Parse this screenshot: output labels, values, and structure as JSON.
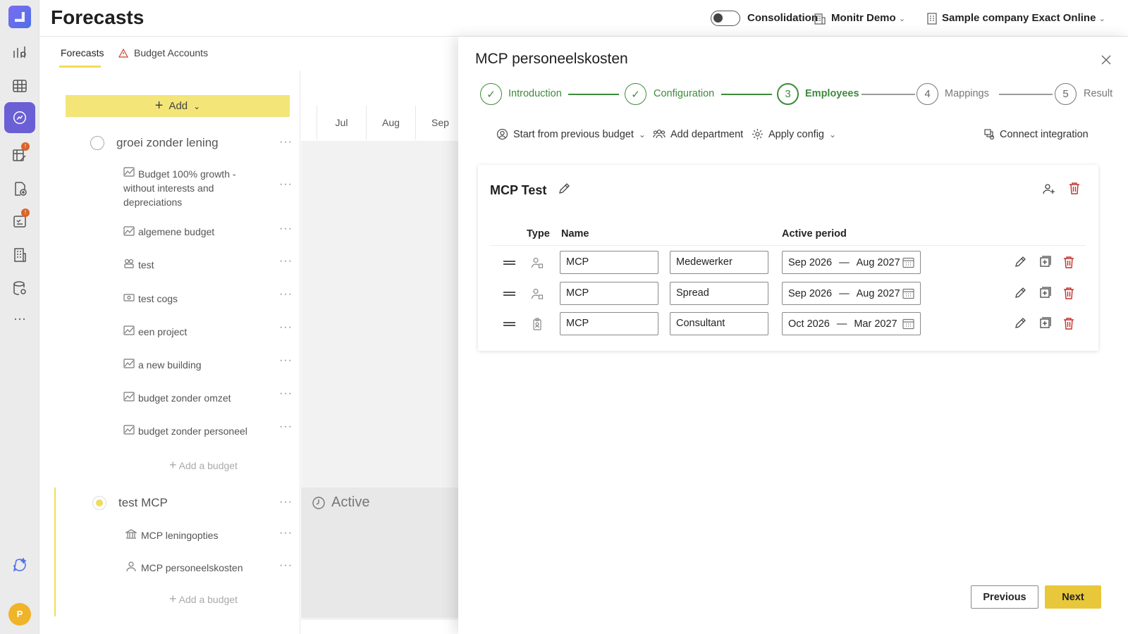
{
  "header": {
    "page_title": "Forecasts",
    "consolidation_label": "Consolidation",
    "org_label": "Monitr Demo",
    "company_label": "Sample company Exact Online"
  },
  "tabs": [
    {
      "label": "Forecasts",
      "active": true
    },
    {
      "label": "Budget Accounts",
      "active": false,
      "icon": "warning-icon"
    }
  ],
  "toolbar": {
    "add_label": "Add"
  },
  "grid_months": [
    "Jul",
    "Aug",
    "Sep"
  ],
  "tree": {
    "group1": {
      "label": "groei zonder lening",
      "items": [
        {
          "label": "Budget 100% growth -",
          "label2": "without interests and",
          "label3": "depreciations",
          "icon": "scenario-icon"
        },
        {
          "label": "algemene budget",
          "icon": "scenario-icon"
        },
        {
          "label": "test",
          "icon": "group-icon"
        },
        {
          "label": "test cogs",
          "icon": "money-icon"
        },
        {
          "label": "een project",
          "icon": "scenario-icon"
        },
        {
          "label": "a new building",
          "icon": "scenario-icon"
        },
        {
          "label": "budget zonder omzet",
          "icon": "scenario-icon"
        },
        {
          "label": "budget zonder personeel",
          "icon": "scenario-icon"
        }
      ],
      "add_label": "Add a budget"
    },
    "group2": {
      "label": "test MCP",
      "status_label": "Active",
      "items": [
        {
          "label": "MCP leningopties",
          "icon": "bank-icon"
        },
        {
          "label": "MCP personeelskosten",
          "icon": "person-icon"
        }
      ],
      "add_label": "Add a budget"
    }
  },
  "modal": {
    "title": "MCP personeelskosten",
    "steps": [
      {
        "number": "1",
        "label": "Introduction",
        "state": "done"
      },
      {
        "number": "2",
        "label": "Configuration",
        "state": "done"
      },
      {
        "number": "3",
        "label": "Employees",
        "state": "current"
      },
      {
        "number": "4",
        "label": "Mappings",
        "state": "todo"
      },
      {
        "number": "5",
        "label": "Result",
        "state": "todo"
      }
    ],
    "actions": {
      "start_previous": "Start from previous budget",
      "add_department": "Add department",
      "apply_config": "Apply config",
      "connect_integration": "Connect integration"
    },
    "department": {
      "title": "MCP Test",
      "columns": {
        "type": "Type",
        "name": "Name",
        "active_period": "Active period"
      },
      "rows": [
        {
          "type_icon": "employee-icon",
          "name": "MCP",
          "role": "Medewerker",
          "from": "Sep 2026",
          "to": "Aug 2027"
        },
        {
          "type_icon": "employee-icon",
          "name": "MCP",
          "role": "Spread",
          "from": "Sep 2026",
          "to": "Aug 2027"
        },
        {
          "type_icon": "badge-icon",
          "name": "MCP",
          "role": "Consultant",
          "from": "Oct 2026",
          "to": "Mar 2027"
        }
      ]
    },
    "buttons": {
      "previous": "Previous",
      "next": "Next"
    }
  },
  "colors": {
    "accent_yellow": "#e8c73a",
    "step_green": "#3d8a3a",
    "delete_red": "#c2332e",
    "rail_active": "#6b5fd6"
  },
  "avatar_initial": "P"
}
